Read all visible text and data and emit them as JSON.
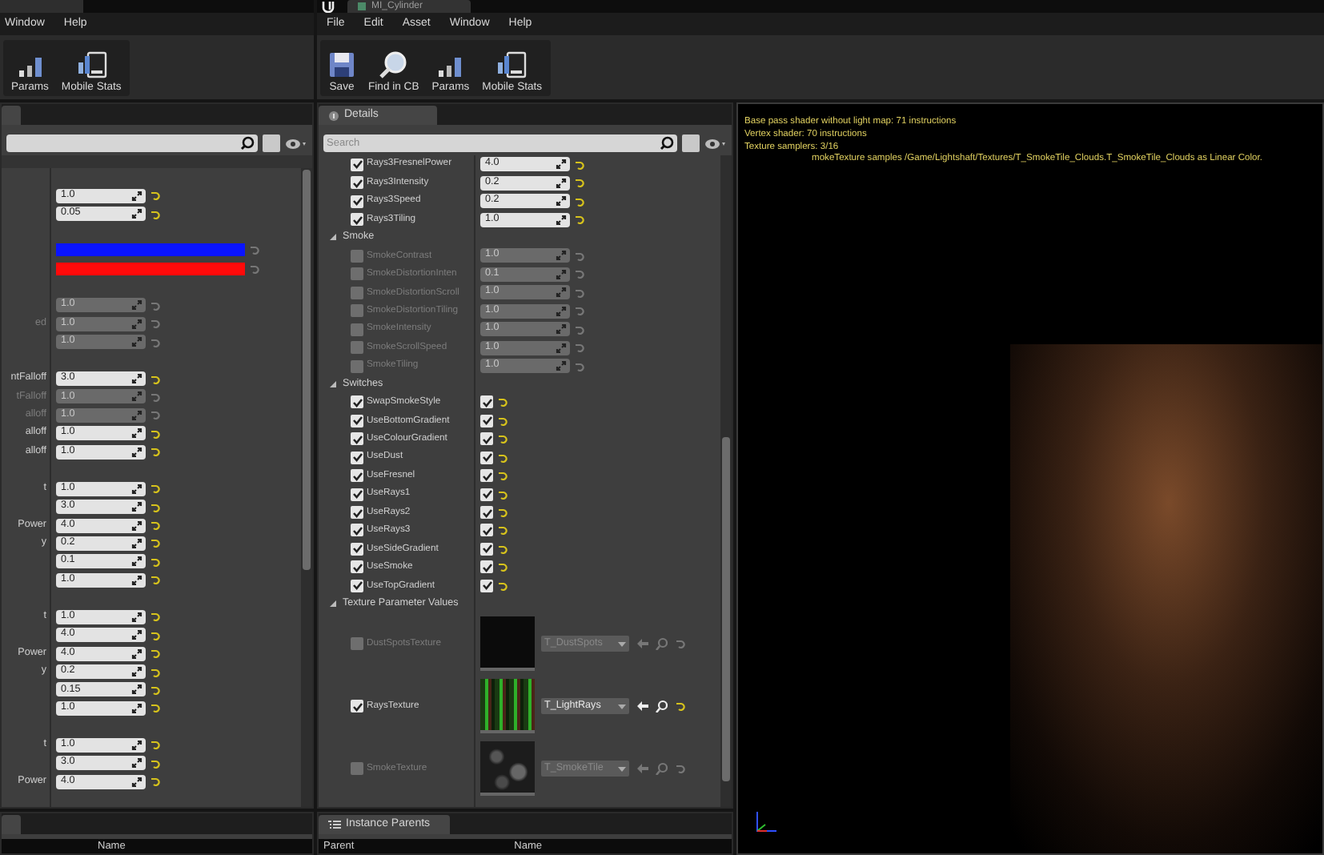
{
  "left_editor": {
    "menu": [
      "Window",
      "Help"
    ],
    "toolbar": [
      {
        "kind": "params",
        "label": "Params"
      },
      {
        "kind": "mobile",
        "label": "Mobile Stats"
      }
    ],
    "rows": [
      {
        "kind": "gap"
      },
      {
        "kind": "number",
        "value": "1.0",
        "enabled": true
      },
      {
        "kind": "number",
        "value": "0.05",
        "enabled": true
      },
      {
        "kind": "gap"
      },
      {
        "kind": "color",
        "color": "#0a14ff"
      },
      {
        "kind": "color",
        "color": "#ff0a0a"
      },
      {
        "kind": "gap"
      },
      {
        "kind": "number",
        "value": "1.0",
        "enabled": false
      },
      {
        "kind": "number",
        "label": "ed",
        "value": "1.0",
        "enabled": false
      },
      {
        "kind": "number",
        "value": "1.0",
        "enabled": false
      },
      {
        "kind": "gap"
      },
      {
        "kind": "number",
        "label": "ntFalloff",
        "value": "3.0",
        "enabled": true
      },
      {
        "kind": "number",
        "label": "tFalloff",
        "value": "1.0",
        "enabled": false
      },
      {
        "kind": "number",
        "label": "alloff",
        "value": "1.0",
        "enabled": false
      },
      {
        "kind": "number",
        "label": "alloff",
        "value": "1.0",
        "enabled": true
      },
      {
        "kind": "number",
        "label": "alloff",
        "value": "1.0",
        "enabled": true
      },
      {
        "kind": "gap"
      },
      {
        "kind": "number",
        "label": "t",
        "value": "1.0",
        "enabled": true
      },
      {
        "kind": "number",
        "value": "3.0",
        "enabled": true
      },
      {
        "kind": "number",
        "label": "Power",
        "value": "4.0",
        "enabled": true
      },
      {
        "kind": "number",
        "label": "y",
        "value": "0.2",
        "enabled": true
      },
      {
        "kind": "number",
        "value": "0.1",
        "enabled": true
      },
      {
        "kind": "number",
        "value": "1.0",
        "enabled": true
      },
      {
        "kind": "gap"
      },
      {
        "kind": "number",
        "label": "t",
        "value": "1.0",
        "enabled": true
      },
      {
        "kind": "number",
        "value": "4.0",
        "enabled": true
      },
      {
        "kind": "number",
        "label": "Power",
        "value": "4.0",
        "enabled": true
      },
      {
        "kind": "number",
        "label": "y",
        "value": "0.2",
        "enabled": true
      },
      {
        "kind": "number",
        "value": "0.15",
        "enabled": true
      },
      {
        "kind": "number",
        "value": "1.0",
        "enabled": true
      },
      {
        "kind": "gap"
      },
      {
        "kind": "number",
        "label": "t",
        "value": "1.0",
        "enabled": true
      },
      {
        "kind": "number",
        "value": "3.0",
        "enabled": true
      },
      {
        "kind": "number",
        "label": "Power",
        "value": "4.0",
        "enabled": true
      }
    ],
    "bottom_columns": [
      "Name"
    ]
  },
  "material_editor": {
    "title": "MI_Cylinder",
    "menu": [
      "File",
      "Edit",
      "Asset",
      "Window",
      "Help"
    ],
    "toolbar": [
      {
        "kind": "save",
        "label": "Save"
      },
      {
        "kind": "find",
        "label": "Find in CB"
      },
      {
        "kind": "params",
        "label": "Params"
      },
      {
        "kind": "mobile",
        "label": "Mobile Stats"
      }
    ],
    "details": {
      "tab": "Details",
      "search_placeholder": "Search",
      "rows": [
        {
          "kind": "scalar",
          "label": "Rays3FresnelPower",
          "value": "4.0",
          "checked": true
        },
        {
          "kind": "scalar",
          "label": "Rays3Intensity",
          "value": "0.2",
          "checked": true
        },
        {
          "kind": "scalar",
          "label": "Rays3Speed",
          "value": "0.2",
          "checked": true
        },
        {
          "kind": "scalar",
          "label": "Rays3Tiling",
          "value": "1.0",
          "checked": true
        },
        {
          "kind": "category",
          "label": "Smoke",
          "expanded": true
        },
        {
          "kind": "scalar",
          "label": "SmokeContrast",
          "value": "1.0",
          "checked": false
        },
        {
          "kind": "scalar",
          "label": "SmokeDistortionInten",
          "value": "0.1",
          "checked": false
        },
        {
          "kind": "scalar",
          "label": "SmokeDistortionScroll",
          "value": "1.0",
          "checked": false
        },
        {
          "kind": "scalar",
          "label": "SmokeDistortionTiling",
          "value": "1.0",
          "checked": false
        },
        {
          "kind": "scalar",
          "label": "SmokeIntensity",
          "value": "1.0",
          "checked": false
        },
        {
          "kind": "scalar",
          "label": "SmokeScrollSpeed",
          "value": "1.0",
          "checked": false
        },
        {
          "kind": "scalar",
          "label": "SmokeTiling",
          "value": "1.0",
          "checked": false
        },
        {
          "kind": "category",
          "label": "Switches",
          "expanded": true
        },
        {
          "kind": "switch",
          "label": "SwapSmokeStyle",
          "checked": true,
          "value_checked": true
        },
        {
          "kind": "switch",
          "label": "UseBottomGradient",
          "checked": true,
          "value_checked": true
        },
        {
          "kind": "switch",
          "label": "UseColourGradient",
          "checked": true,
          "value_checked": true
        },
        {
          "kind": "switch",
          "label": "UseDust",
          "checked": true,
          "value_checked": true
        },
        {
          "kind": "switch",
          "label": "UseFresnel",
          "checked": true,
          "value_checked": true
        },
        {
          "kind": "switch",
          "label": "UseRays1",
          "checked": true,
          "value_checked": true
        },
        {
          "kind": "switch",
          "label": "UseRays2",
          "checked": true,
          "value_checked": true
        },
        {
          "kind": "switch",
          "label": "UseRays3",
          "checked": true,
          "value_checked": true
        },
        {
          "kind": "switch",
          "label": "UseSideGradient",
          "checked": true,
          "value_checked": true
        },
        {
          "kind": "switch",
          "label": "UseSmoke",
          "checked": true,
          "value_checked": true
        },
        {
          "kind": "switch",
          "label": "UseTopGradient",
          "checked": true,
          "value_checked": true
        },
        {
          "kind": "category",
          "label": "Texture Parameter Values",
          "expanded": true
        },
        {
          "kind": "texture",
          "label": "DustSpotsTexture",
          "value": "T_DustSpots",
          "checked": false,
          "preview": {
            "kind": "dark"
          }
        },
        {
          "kind": "texture",
          "label": "RaysTexture",
          "value": "T_LightRays",
          "checked": true,
          "preview": {
            "kind": "stripes"
          }
        },
        {
          "kind": "texture",
          "label": "SmokeTexture",
          "value": "T_SmokeTile",
          "checked": false,
          "preview": {
            "kind": "noise"
          }
        }
      ]
    },
    "instance_parents": {
      "tab": "Instance Parents",
      "columns": [
        "Parent",
        "Name"
      ]
    },
    "viewport": {
      "stats": [
        {
          "text": "Base pass shader without light map: 71 instructions",
          "indented": false
        },
        {
          "text": "Vertex shader: 70 instructions",
          "indented": false
        },
        {
          "text": "Texture samplers: 3/16",
          "indented": false
        },
        {
          "text": "mokeTexture samples /Game/Lightshaft/Textures/T_SmokeTile_Clouds.T_SmokeTile_Clouds as Linear Color.",
          "indented": true
        }
      ]
    }
  }
}
